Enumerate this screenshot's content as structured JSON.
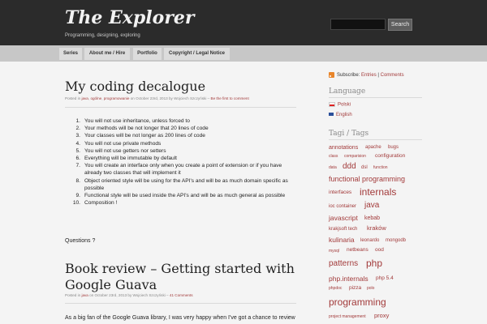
{
  "header": {
    "title": "The Explorer",
    "tagline": "Programming, designing, exploring",
    "search": {
      "placeholder": "",
      "button_label": "Search"
    }
  },
  "nav": {
    "items": [
      {
        "label": "Series"
      },
      {
        "label": "About me / Hire"
      },
      {
        "label": "Portfolio"
      },
      {
        "label": "Copyright / Legal Notice"
      }
    ]
  },
  "posts": [
    {
      "title": "My coding decalogue",
      "meta": {
        "posted_in": "Posted in",
        "categories": [
          "java",
          "ogólne",
          "programowanie"
        ],
        "date_by": "on October 23rd, 2013 by Wojciech Szczyński –",
        "comments": "Be the first to comment"
      },
      "list": [
        {
          "num": "1.",
          "text": "You will not use inheritance, unless forced to"
        },
        {
          "num": "2.",
          "text": "Your methods will be not longer that 20 lines of code"
        },
        {
          "num": "3.",
          "text": "Your classes will be not longer as 200 lines of code"
        },
        {
          "num": "4.",
          "text": "You will not use private methods"
        },
        {
          "num": "5.",
          "text": "You will not use getters nor setters"
        },
        {
          "num": "6.",
          "text": "Everything will be immutable by default"
        },
        {
          "num": "7.",
          "text": "You will create an interface only when you create a point of extension or if you have already two classes that will implement it"
        },
        {
          "num": "8.",
          "text": "Object oriented style will be using for the API's and will be as much domain specific as possible"
        },
        {
          "num": "9.",
          "text": "Functional style will be used inside the API's and will be as much general as possible"
        },
        {
          "num": "10.",
          "text": "Composition !"
        }
      ],
      "footer": "Questions ?"
    },
    {
      "title_line1": "Book review – Getting started with",
      "title_line2": "Google Guava",
      "meta": {
        "posted_in": "Posted in",
        "categories": [
          "java"
        ],
        "date_by": "on October 23rd, 2013 by Wojciech Szczyński –",
        "comments": "41 Comments"
      },
      "excerpt": "As a big fan of the Google Guava library, I was very happy when I've got a chance to review"
    }
  ],
  "sidebar": {
    "subscribe": {
      "label": "Subscribe:",
      "entries": "Entries",
      "sep": "|",
      "comments": "Comments"
    },
    "language": {
      "heading": "Language",
      "items": [
        "Polski",
        "English"
      ]
    },
    "tags": {
      "heading": "Tagi / Tags",
      "items": [
        "annotations",
        "apache",
        "bugs",
        "class",
        "comparision",
        "configuration",
        "data",
        "ddd",
        "dsl",
        "function",
        "functional programming",
        "interfaces",
        "internals",
        "ioc container",
        "java",
        "javascript",
        "kebab",
        "krakjsoft tech",
        "kraków",
        "kulinaria",
        "leonardo",
        "mongodb",
        "mysql",
        "netbeans",
        "ood",
        "patterns",
        "php",
        "php.internals",
        "php 5.4",
        "phpdoc",
        "pizza",
        "polo",
        "programming",
        "project management",
        "proxy"
      ]
    }
  },
  "colors": {
    "header_bg": "#2b2b2b",
    "nav_bg": "#c7c7c7",
    "link": "#a23a3a",
    "page_bg": "#f4f4f4"
  }
}
